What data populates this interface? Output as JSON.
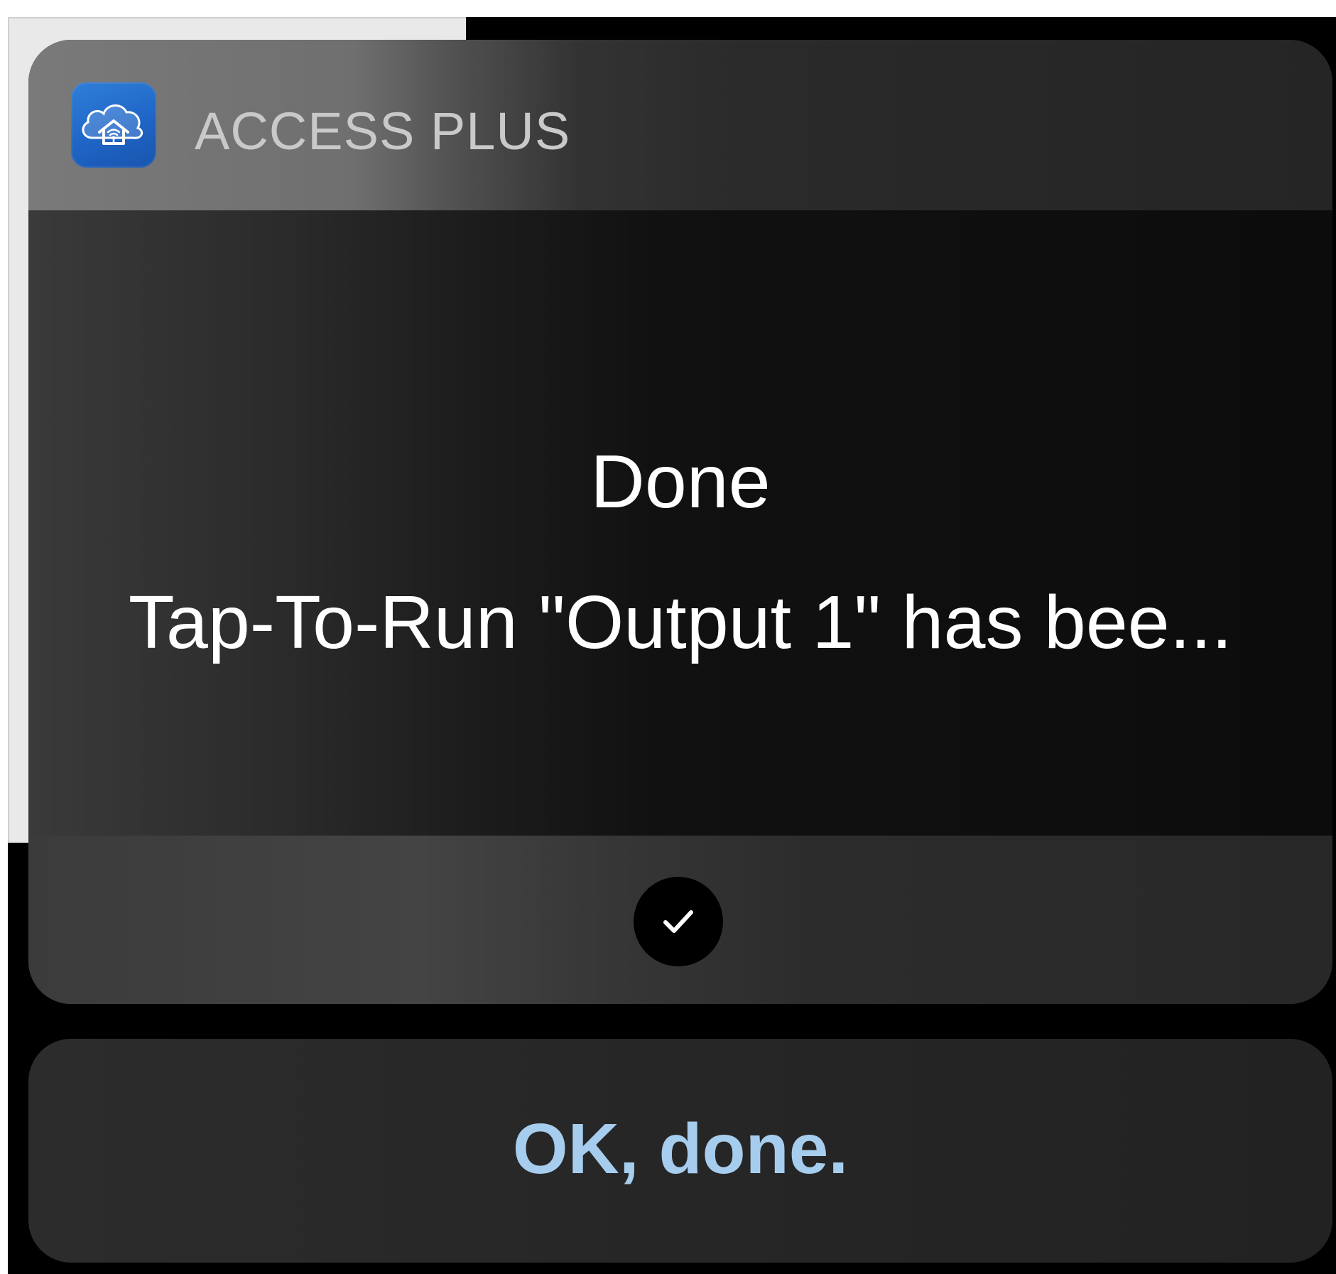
{
  "notification": {
    "app_name": "ACCESS PLUS",
    "app_icon": "cloud-home-wifi-icon",
    "title": "Done",
    "message": "Tap-To-Run \"Output 1\" has bee...",
    "confirm_icon": "checkmark-icon"
  },
  "action": {
    "label": "OK, done."
  },
  "colors": {
    "icon_background": "#1e63c4",
    "action_text": "#a6cdee",
    "app_name_text": "#c9c9c9"
  }
}
